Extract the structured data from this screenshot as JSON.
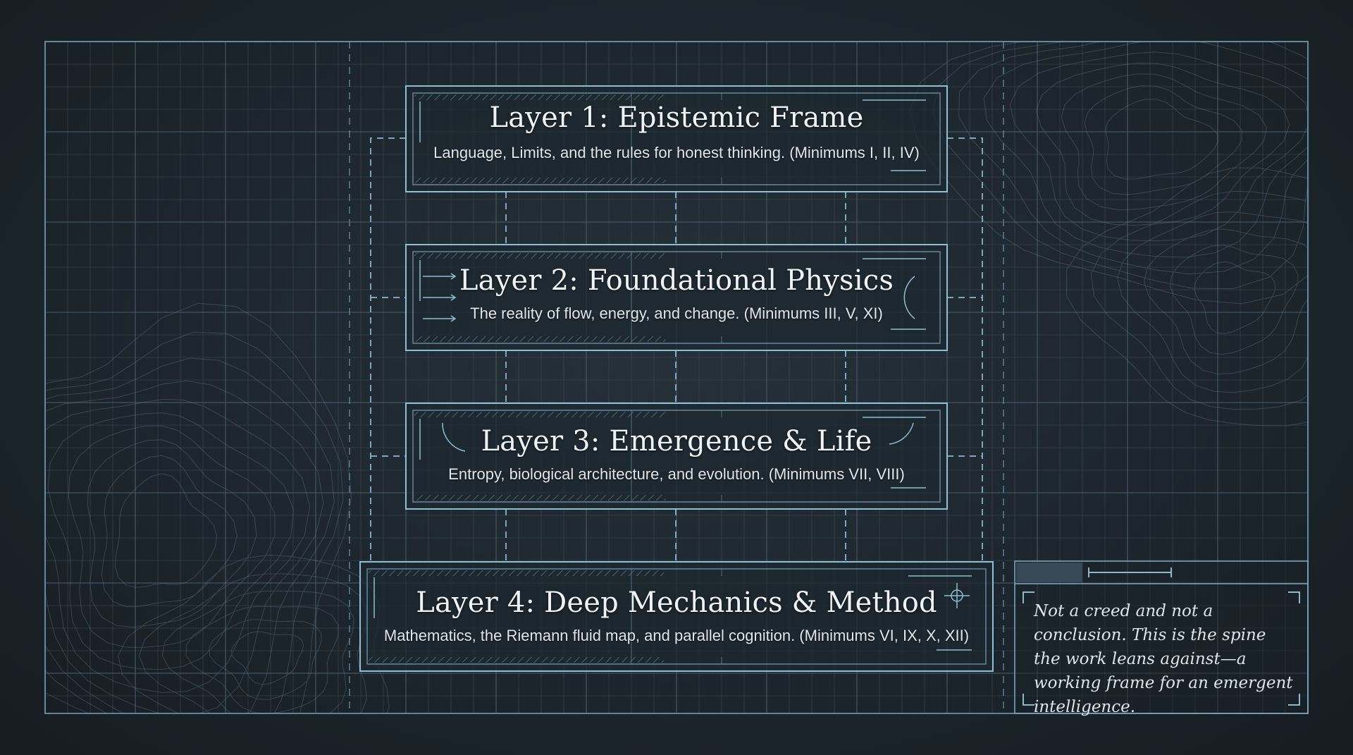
{
  "diagram": {
    "layers": [
      {
        "title": "Layer 1: Epistemic Frame",
        "subtitle": "Language, Limits, and the rules for honest thinking. (Minimums I, II, IV)"
      },
      {
        "title": "Layer 2: Foundational Physics",
        "subtitle": "The reality of flow, energy, and change. (Minimums III, V, XI)"
      },
      {
        "title": "Layer 3: Emergence & Life",
        "subtitle": "Entropy, biological architecture, and evolution. (Minimums VII, VIII)"
      },
      {
        "title": "Layer 4: Deep Mechanics & Method",
        "subtitle": "Mathematics, the Riemann fluid map, and parallel cognition. (Minimums VI, IX, X, XII)"
      }
    ],
    "note": "Not a creed and not a conclusion. This is the spine the work leans against—a working frame for an emergent intelligence."
  },
  "colors": {
    "background": "#1c242c",
    "line": "#7fb0c4",
    "grid": "#3a4a56",
    "text": "#e6edf3"
  }
}
